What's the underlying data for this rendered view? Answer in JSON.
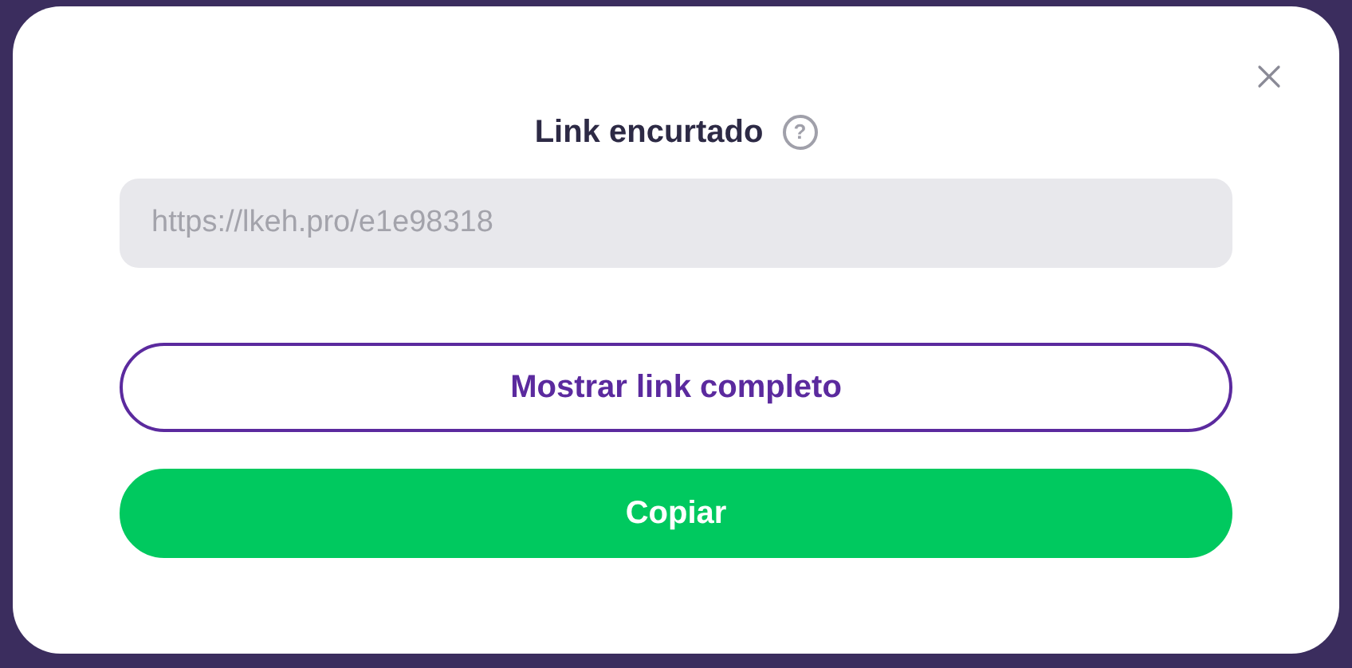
{
  "dialog": {
    "title": "Link encurtado",
    "help": "?"
  },
  "link_field": {
    "value": "https://lkeh.pro/e1e98318"
  },
  "buttons": [
    {
      "label": "Mostrar link completo",
      "kind": "outline"
    },
    {
      "label": "Copiar",
      "kind": "primary"
    }
  ]
}
